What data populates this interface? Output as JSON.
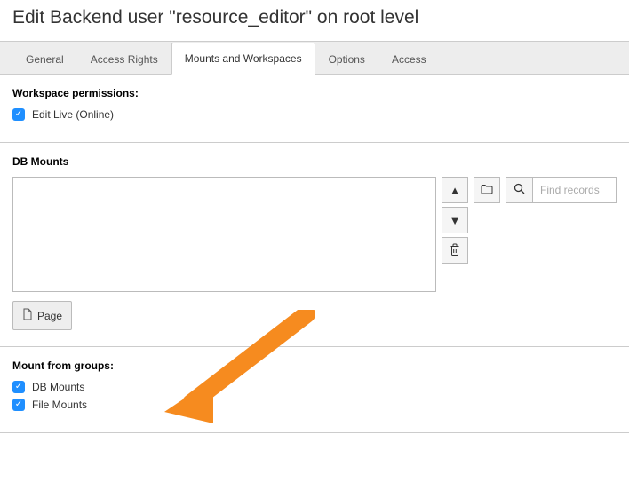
{
  "page_title": "Edit Backend user \"resource_editor\" on root level",
  "tabs": {
    "general": "General",
    "access_rights": "Access Rights",
    "mounts": "Mounts and Workspaces",
    "options": "Options",
    "access": "Access"
  },
  "workspace": {
    "heading": "Workspace permissions:",
    "edit_live_label": "Edit Live (Online)"
  },
  "db_mounts": {
    "heading": "DB Mounts",
    "find_placeholder": "Find records",
    "page_btn_label": "Page"
  },
  "mount_from_groups": {
    "heading": "Mount from groups:",
    "db_mounts_label": "DB Mounts",
    "file_mounts_label": "File Mounts"
  }
}
